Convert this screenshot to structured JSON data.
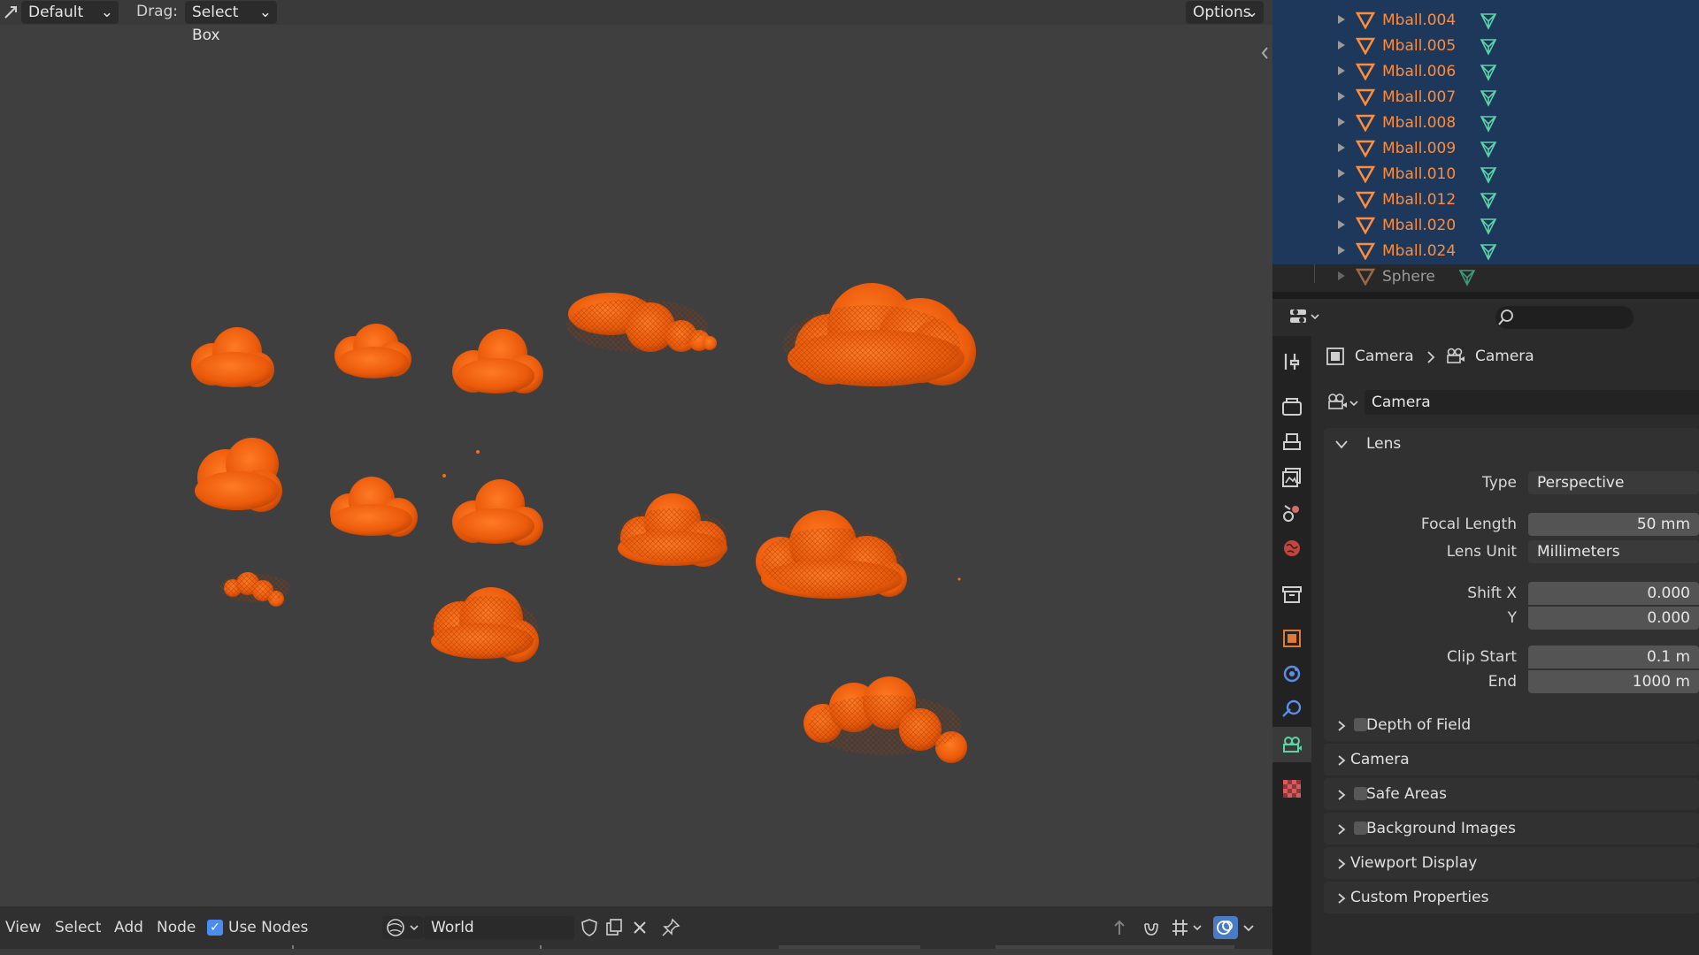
{
  "viewport_header": {
    "mode": "Default",
    "drag_label": "Drag:",
    "drag_value": "Select Box",
    "options": "Options"
  },
  "outliner": {
    "items": [
      {
        "name": "Mball.004",
        "selected": true
      },
      {
        "name": "Mball.005",
        "selected": true
      },
      {
        "name": "Mball.006",
        "selected": true
      },
      {
        "name": "Mball.007",
        "selected": true
      },
      {
        "name": "Mball.008",
        "selected": true
      },
      {
        "name": "Mball.009",
        "selected": true
      },
      {
        "name": "Mball.010",
        "selected": true
      },
      {
        "name": "Mball.012",
        "selected": true
      },
      {
        "name": "Mball.020",
        "selected": true
      },
      {
        "name": "Mball.024",
        "selected": true
      },
      {
        "name": "Sphere",
        "selected": false
      }
    ]
  },
  "properties": {
    "breadcrumb": {
      "object": "Camera",
      "data": "Camera"
    },
    "datablock": "Camera",
    "lens_panel": "Lens",
    "type_label": "Type",
    "type_value": "Perspective",
    "focal_length_label": "Focal Length",
    "focal_length_value": "50 mm",
    "lens_unit_label": "Lens Unit",
    "lens_unit_value": "Millimeters",
    "shift_x_label": "Shift X",
    "shift_x_value": "0.000",
    "shift_y_label": "Y",
    "shift_y_value": "0.000",
    "clip_start_label": "Clip Start",
    "clip_start_value": "0.1 m",
    "clip_end_label": "End",
    "clip_end_value": "1000 m",
    "panels": {
      "dof": "Depth of Field",
      "camera": "Camera",
      "safe_areas": "Safe Areas",
      "background_images": "Background Images",
      "viewport_display": "Viewport Display",
      "custom_properties": "Custom Properties"
    }
  },
  "node_header": {
    "view": "View",
    "select": "Select",
    "add": "Add",
    "node": "Node",
    "use_nodes": "Use Nodes",
    "use_nodes_checked": true,
    "world": "World"
  },
  "colors": {
    "selection": "#ff6a14",
    "outliner_selected": "#1e385c",
    "object_orange": "#ff8c3a",
    "mesh_green": "#5bd4a6"
  }
}
